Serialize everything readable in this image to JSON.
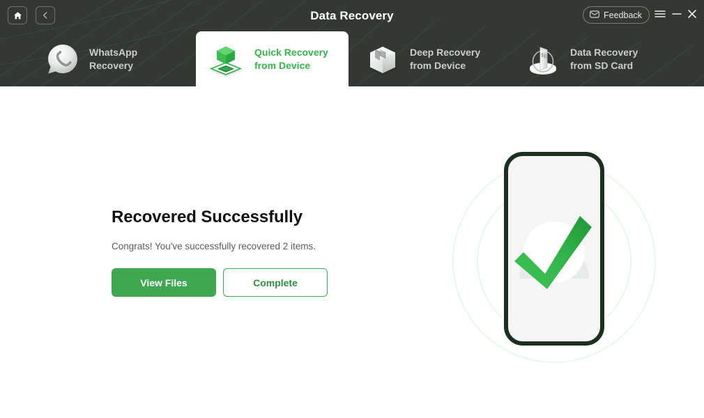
{
  "window": {
    "title": "Data Recovery",
    "home_icon": "home-icon",
    "back_icon": "chevron-left-icon",
    "feedback_label": "Feedback",
    "feedback_icon": "envelope-icon",
    "menu_icon": "hamburger-menu-icon",
    "minimize_icon": "minimize-icon",
    "close_icon": "close-icon",
    "header_bg_color": "#333835",
    "accent_color": "#36b34a"
  },
  "tabs": [
    {
      "id": "whatsapp-recovery",
      "line1": "WhatsApp",
      "line2": "Recovery",
      "label": "WhatsApp\nRecovery",
      "icon": "whatsapp-bubble-icon",
      "active": false
    },
    {
      "id": "quick-recovery-from-device",
      "line1": "Quick Recovery",
      "line2": "from Device",
      "label": "Quick Recovery\nfrom Device",
      "icon": "green-cube-platform-icon",
      "active": true
    },
    {
      "id": "deep-recovery-from-device",
      "line1": "Deep Recovery",
      "line2": "from Device",
      "label": "Deep Recovery\nfrom Device",
      "icon": "open-cube-icon",
      "active": false
    },
    {
      "id": "data-recovery-from-sd-card",
      "line1": "Data Recovery",
      "line2": "from SD Card",
      "label": "Data Recovery\nfrom SD Card",
      "icon": "sd-card-icon",
      "active": false
    }
  ],
  "main": {
    "headline": "Recovered Successfully",
    "subline": "Congrats! You've successfully recovered 2 items.",
    "recovered_count": 2,
    "primary_button": "View Files",
    "secondary_button": "Complete",
    "illustration": {
      "name": "phone-with-green-checkmark",
      "check_color": "#2fb04a",
      "phone_outline_color": "#1c2f21",
      "ring_color": "#e2f5e6"
    }
  }
}
